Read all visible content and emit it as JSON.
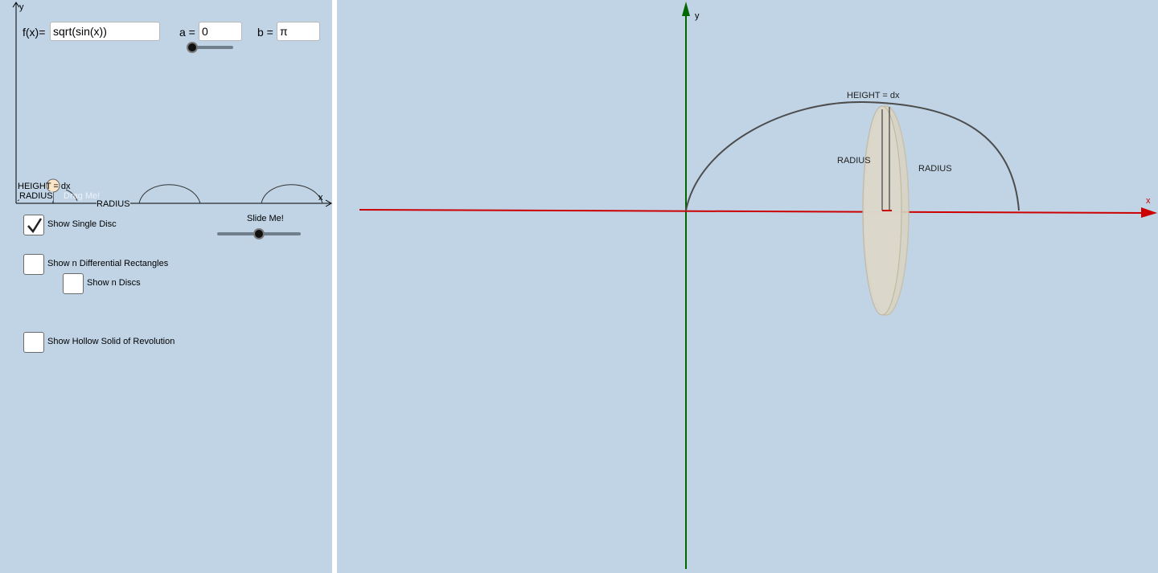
{
  "left": {
    "function_label": "f(x)=",
    "function_value": "sqrt(sin(x))",
    "a_label": "a =",
    "a_value": "0",
    "b_label": "b =",
    "b_value": "π",
    "axis_y": "y",
    "axis_x": "x",
    "plot_height_label": "HEIGHT = dx",
    "plot_radius_label_left": "RADIUS",
    "plot_radius_label_mid": "RADIUS",
    "drag_label": "Drag Me!",
    "slide_label": "Slide Me!",
    "checkboxes": [
      {
        "label": "Show Single Disc",
        "checked": true
      },
      {
        "label": "Show n Differential Rectangles",
        "checked": false
      },
      {
        "label": "Show n Discs",
        "checked": false
      },
      {
        "label": "Show Hollow Solid of Revolution",
        "checked": false
      }
    ]
  },
  "right": {
    "axis_y": "y",
    "axis_x": "x",
    "height_label": "HEIGHT = dx",
    "radius_label_left": "RADIUS",
    "radius_label_right": "RADIUS"
  },
  "colors": {
    "panel_bg": "#c0d4e6",
    "x_axis": "#cc0000",
    "y_axis": "#006600",
    "curve": "#4d4d4d",
    "disc_fill": "#d9d4c4"
  }
}
